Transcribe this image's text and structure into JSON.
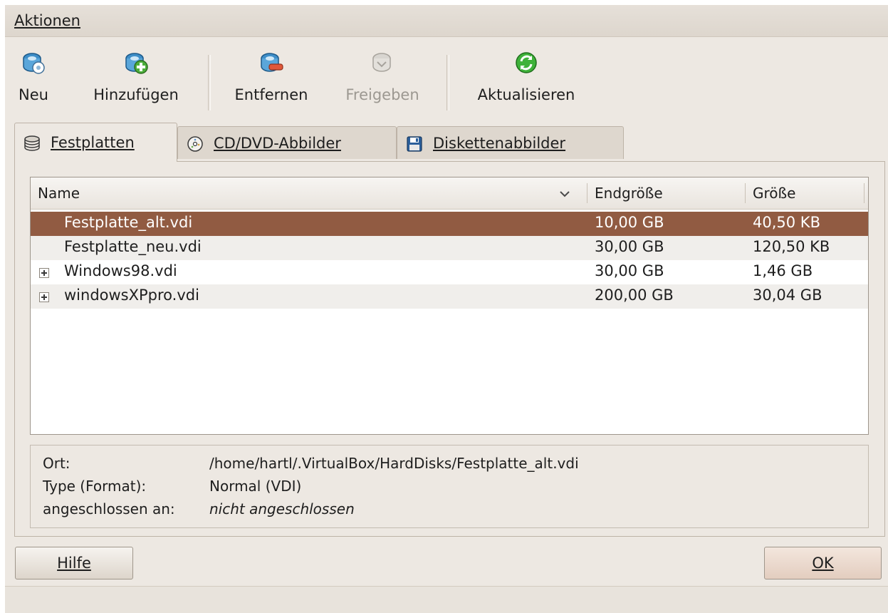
{
  "menu": {
    "label": "Aktionen"
  },
  "toolbar": {
    "new_label": "Neu",
    "add_label": "Hinzufügen",
    "remove_label": "Entfernen",
    "release_label": "Freigeben",
    "refresh_label": "Aktualisieren",
    "release_disabled": true
  },
  "tabs": [
    {
      "label": "Festplatten",
      "icon": "hard-disk-icon",
      "active": true
    },
    {
      "label": "CD/DVD-Abbilder",
      "icon": "cd-dvd-icon",
      "active": false
    },
    {
      "label": "Diskettenabbilder",
      "icon": "floppy-icon",
      "active": false
    }
  ],
  "table": {
    "columns": [
      "Name",
      "Endgröße",
      "Größe"
    ],
    "rows": [
      {
        "name": "Festplatte_alt.vdi",
        "final_size": "10,00 GB",
        "size": "40,50 KB",
        "expandable": false,
        "selected": true
      },
      {
        "name": "Festplatte_neu.vdi",
        "final_size": "30,00 GB",
        "size": "120,50 KB",
        "expandable": false,
        "selected": false
      },
      {
        "name": "Windows98.vdi",
        "final_size": "30,00 GB",
        "size": "1,46 GB",
        "expandable": true,
        "selected": false
      },
      {
        "name": "windowsXPpro.vdi",
        "final_size": "200,00 GB",
        "size": "30,04 GB",
        "expandable": true,
        "selected": false
      }
    ]
  },
  "details": {
    "location_label": "Ort:",
    "location_value": "/home/hartl/.VirtualBox/HardDisks/Festplatte_alt.vdi",
    "type_label": "Type (Format):",
    "type_value": "Normal (VDI)",
    "attached_label": "angeschlossen an:",
    "attached_value": "nicht angeschlossen"
  },
  "buttons": {
    "help": "Hilfe",
    "ok": "OK"
  },
  "colors": {
    "selection": "#915b42",
    "window_bg": "#ede8e2",
    "alt_row": "#f0eeeb"
  }
}
